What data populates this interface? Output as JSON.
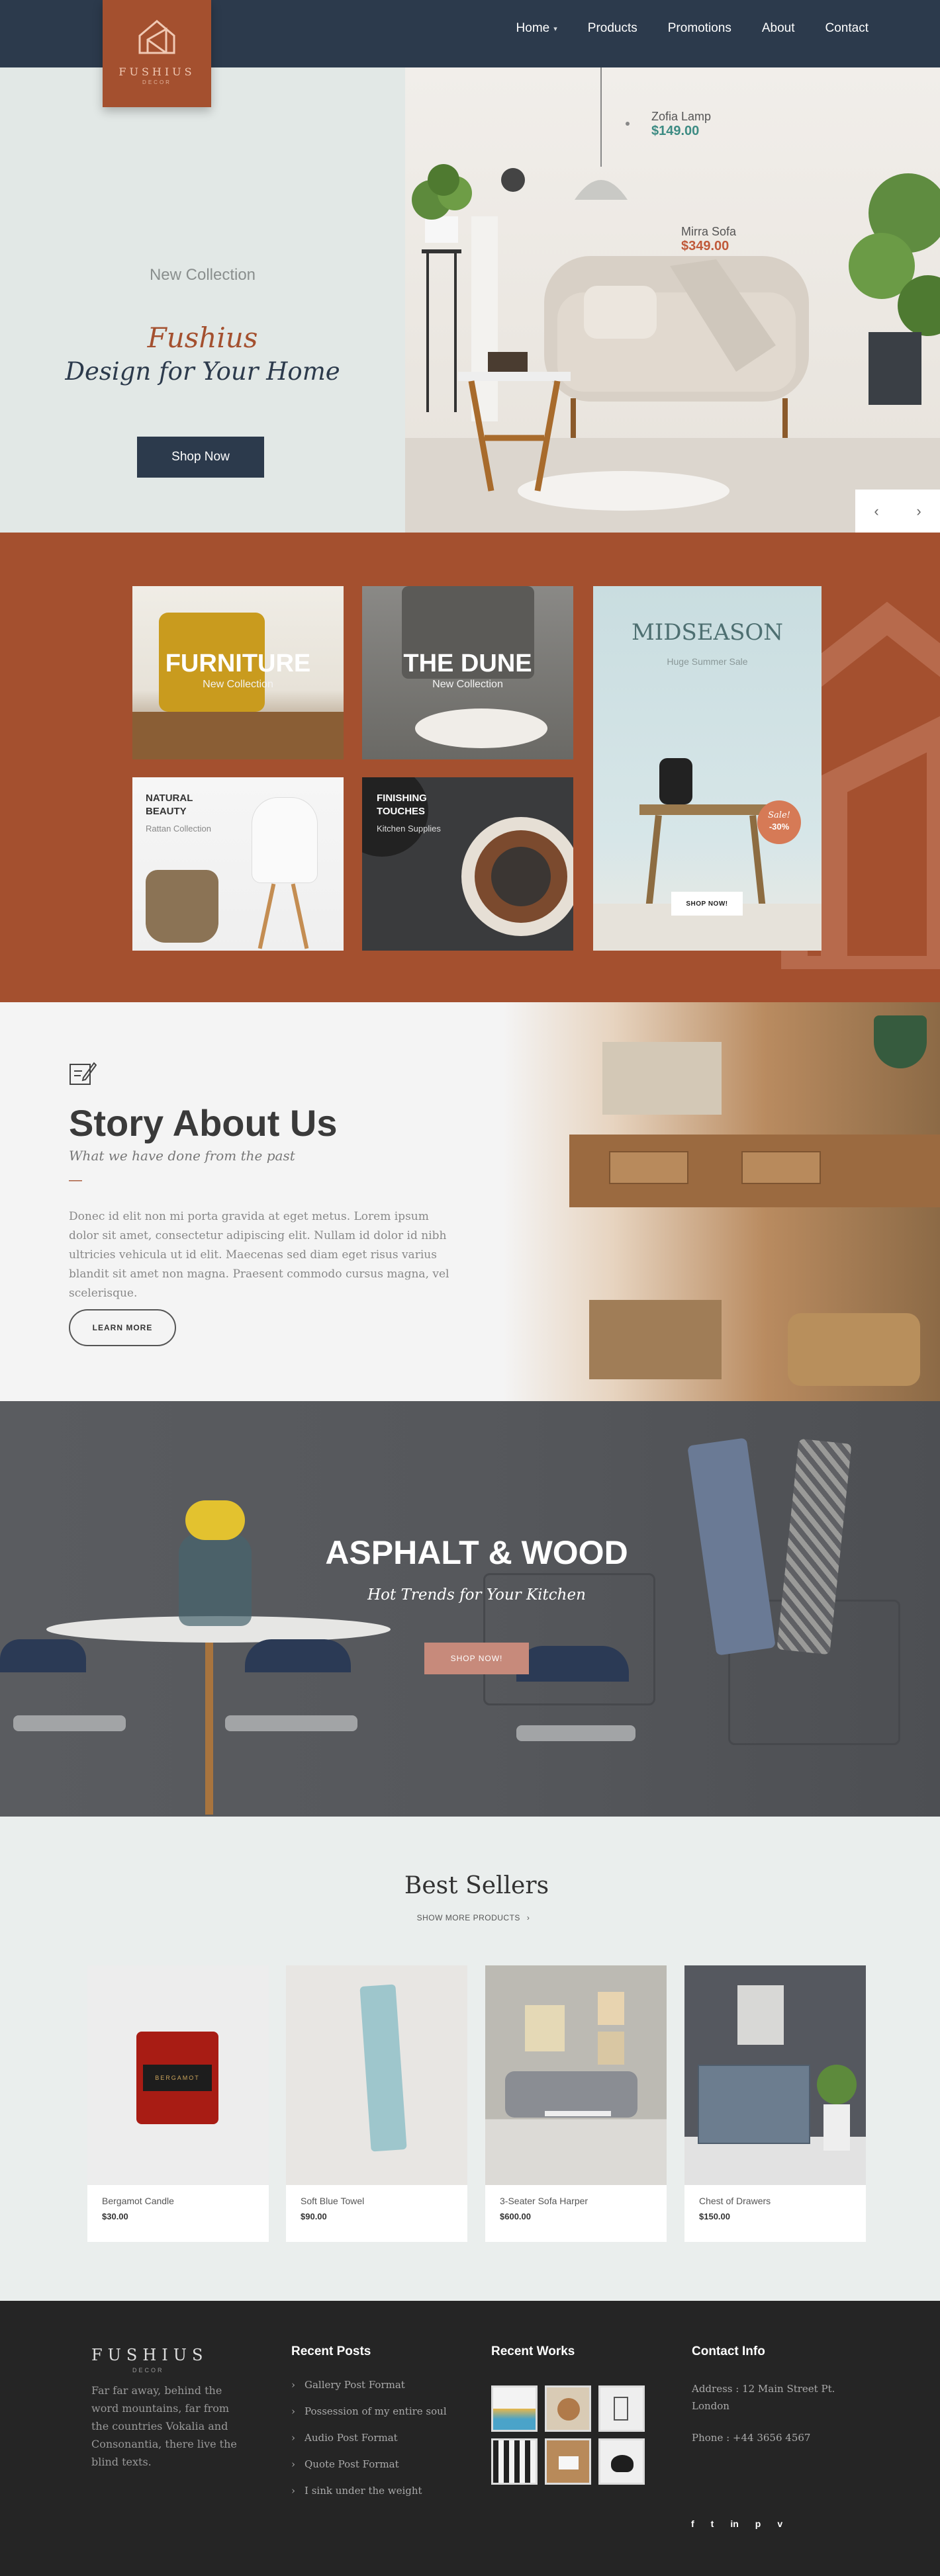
{
  "brand": {
    "name": "FUSHIUS",
    "sub": "DECOR",
    "accent": "#a4502f",
    "navy": "#2c3a4c"
  },
  "nav": {
    "items": [
      {
        "label": "Home",
        "has_dropdown": true
      },
      {
        "label": "Products",
        "has_dropdown": false
      },
      {
        "label": "Promotions",
        "has_dropdown": false
      },
      {
        "label": "About",
        "has_dropdown": false
      },
      {
        "label": "Contact",
        "has_dropdown": false
      }
    ]
  },
  "hero": {
    "eyebrow": "New Collection",
    "title_line1": "Fushius",
    "title_line2": "Design for Your Home",
    "button": "Shop Now",
    "tags": [
      {
        "name": "Zofia Lamp",
        "price": "$149.00"
      },
      {
        "name": "Mirra Sofa",
        "price": "$349.00"
      }
    ],
    "prev_icon": "chevron-left-icon",
    "next_icon": "chevron-right-icon"
  },
  "collections": {
    "furniture": {
      "title": "FURNITURE",
      "sub": "New Collection"
    },
    "dune": {
      "title": "THE DUNE",
      "sub": "New Collection"
    },
    "natural": {
      "title_line1": "NATURAL",
      "title_line2": "BEAUTY",
      "sub": "Rattan Collection"
    },
    "finishing": {
      "title_line1": "FINISHING",
      "title_line2": "TOUCHES",
      "sub": "Kitchen Supplies"
    },
    "midseason": {
      "title": "MIDSEASON",
      "sub": "Huge Summer Sale",
      "badge_line1": "Sale!",
      "badge_line2": "-30%",
      "button": "SHOP NOW!"
    }
  },
  "story": {
    "icon": "edit-note-icon",
    "title": "Story About Us",
    "subtitle": "What we have done from the past",
    "divider": "—",
    "body": "Donec id elit non mi porta gravida at eget metus. Lorem ipsum dolor sit amet, consectetur adipiscing elit. Nullam id dolor id nibh ultricies vehicula ut id elit. Maecenas sed diam eget risus varius blandit sit amet non magna. Praesent commodo cursus magna, vel scelerisque.",
    "button": "LEARN MORE"
  },
  "asphalt": {
    "title": "ASPHALT & WOOD",
    "subtitle": "Hot Trends for Your Kitchen",
    "button": "SHOP NOW!"
  },
  "best_sellers": {
    "title": "Best Sellers",
    "link": "SHOW MORE PRODUCTS",
    "link_icon": "chevron-right-icon",
    "products": [
      {
        "name": "Bergamot Candle",
        "price": "$30.00",
        "label_text": "BERGAMOT"
      },
      {
        "name": "Soft Blue Towel",
        "price": "$90.00"
      },
      {
        "name": "3-Seater Sofa Harper",
        "price": "$600.00"
      },
      {
        "name": "Chest of Drawers",
        "price": "$150.00"
      }
    ]
  },
  "footer": {
    "logo": "FUSHIUS",
    "logo_sub": "DECOR",
    "about": "Far far away, behind the word mountains, far from the countries Vokalia and Consonantia, there live the blind texts.",
    "posts_title": "Recent Posts",
    "posts": [
      "Gallery Post Format",
      "Possession of my entire soul",
      "Audio Post Format",
      "Quote Post Format",
      "I sink under the weight"
    ],
    "works_title": "Recent Works",
    "contact_title": "Contact Info",
    "address": "Address : 12 Main Street Pt. London",
    "phone": "Phone : +44 3656 4567",
    "social": [
      {
        "icon": "facebook-icon",
        "glyph": "f"
      },
      {
        "icon": "twitter-icon",
        "glyph": "t"
      },
      {
        "icon": "linkedin-icon",
        "glyph": "in"
      },
      {
        "icon": "pinterest-icon",
        "glyph": "p"
      },
      {
        "icon": "vimeo-icon",
        "glyph": "v"
      }
    ]
  }
}
